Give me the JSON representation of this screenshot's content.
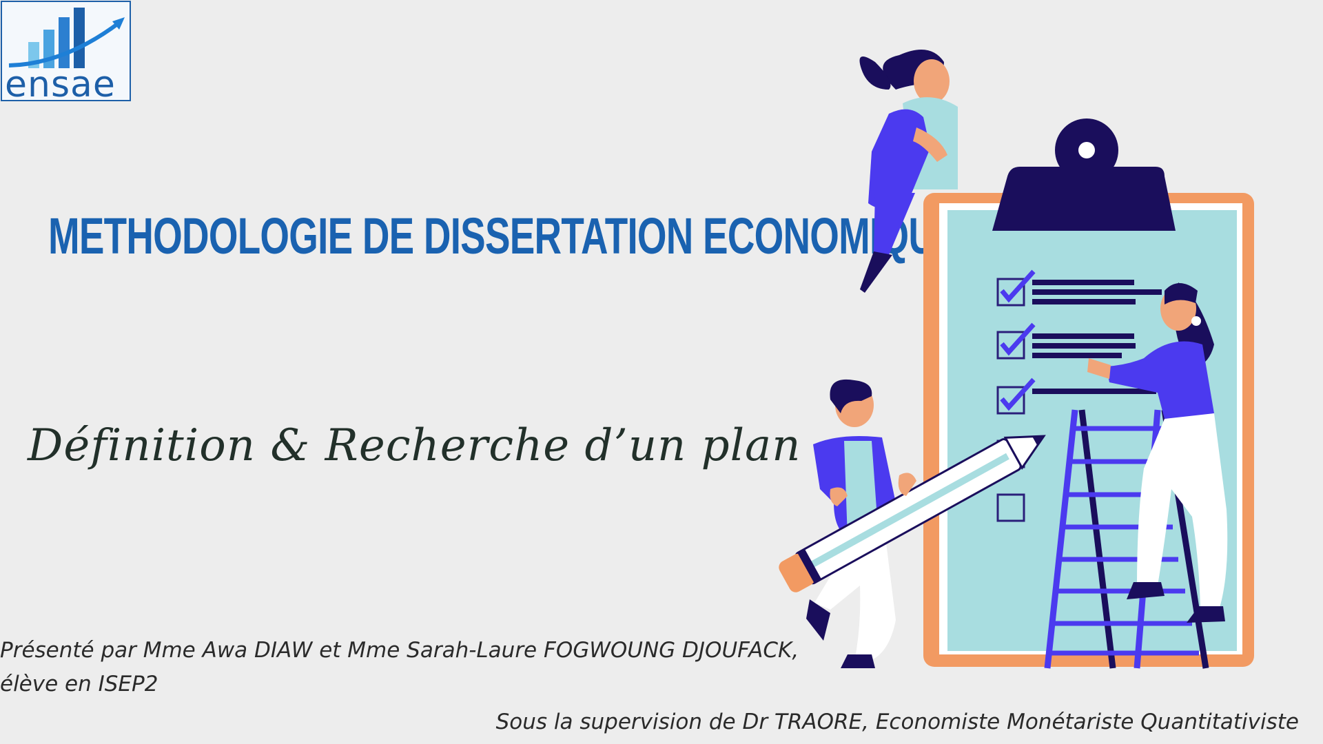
{
  "logo": {
    "text": "ensae",
    "icon": "rising-bar-chart-arrow-icon"
  },
  "slide": {
    "title": "METHODOLOGIE DE DISSERTATION ECONOMIQUE",
    "subtitle": "Définition & Recherche d’un plan",
    "presenter_line1": "Présenté par Mme Awa DIAW et Mme Sarah-Laure FOGWOUNG DJOUFACK,",
    "presenter_line2": "élève en ISEP2",
    "supervision": "Sous la supervision de Dr TRAORE, Economiste Monétariste Quantitativiste"
  },
  "illustration": {
    "icon": "clipboard-checklist-team-illustration",
    "checklist": [
      {
        "checked": true
      },
      {
        "checked": true
      },
      {
        "checked": true
      },
      {
        "checked": false
      },
      {
        "checked": false
      }
    ]
  },
  "colors": {
    "title": "#1a62b0",
    "subtitle": "#22302a",
    "clipboard_frame": "#f29a62",
    "clipboard_paper": "#a8dde0",
    "navy": "#1a0e5c",
    "violet": "#4b3aef",
    "background": "#ededed"
  }
}
